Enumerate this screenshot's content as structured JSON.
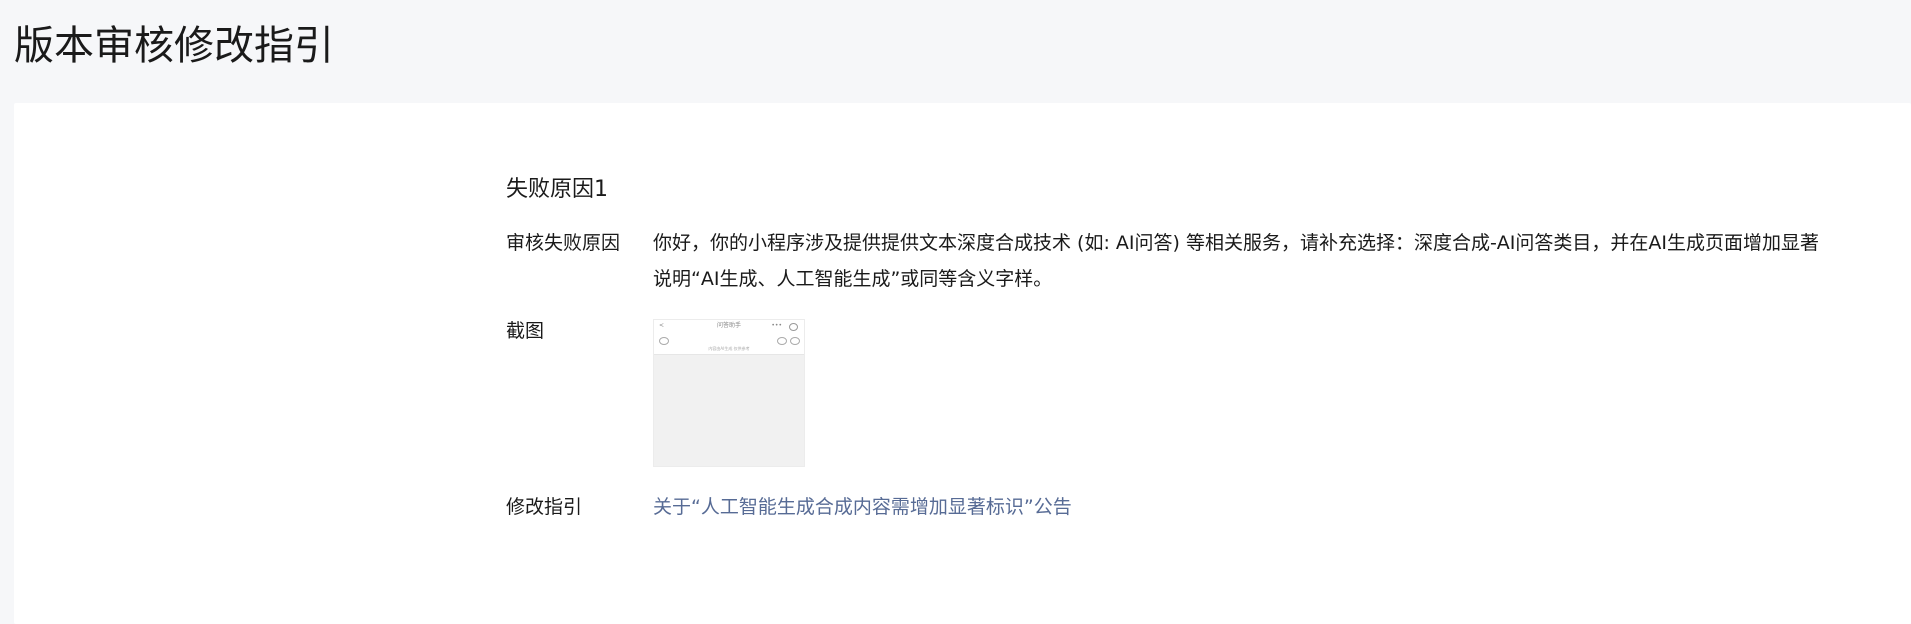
{
  "page": {
    "title": "版本审核修改指引"
  },
  "failure": {
    "section_title": "失败原因1",
    "reason_label": "审核失败原因",
    "reason_text": "你好，你的小程序涉及提供提供文本深度合成技术 (如: AI问答) 等相关服务，请补充选择：深度合成-AI问答类目，并在AI生成页面增加显著说明“AI生成、人工智能生成”或同等含义字样。",
    "screenshot_label": "截图",
    "screenshot": {
      "nav_back": "<",
      "nav_title": "问答助手",
      "nav_dots": "•••",
      "hint_text": "内容由AI生成 仅供参考"
    },
    "guide_label": "修改指引",
    "guide_link_text": "关于“人工智能生成合成内容需增加显著标识”公告"
  }
}
